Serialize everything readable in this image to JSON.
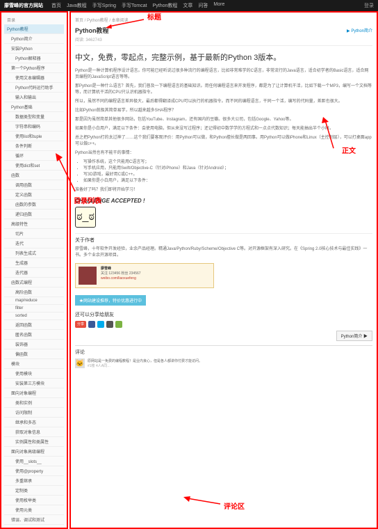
{
  "topbar": {
    "site": "廖雪峰的官方网站",
    "nav": [
      "首页",
      "Java教程",
      "手写Spring",
      "手写Tomcat",
      "Python教程",
      "文章",
      "问答",
      "More"
    ],
    "login": "登录"
  },
  "sidebar": {
    "label_toc": "目录",
    "items": [
      {
        "t": "Python教程",
        "cls": "active"
      },
      {
        "t": "Python简介",
        "cls": "sub"
      },
      {
        "t": "安装Python",
        "cls": "sub"
      },
      {
        "t": "Python解释器",
        "cls": "sub2"
      },
      {
        "t": "第一个Python程序",
        "cls": "sub"
      },
      {
        "t": "使用文本编辑器",
        "cls": "sub2"
      },
      {
        "t": "Python代码运行助手",
        "cls": "sub2"
      },
      {
        "t": "输入和输出",
        "cls": "sub2"
      },
      {
        "t": "Python基础",
        "cls": "sub"
      },
      {
        "t": "数据类型和变量",
        "cls": "sub2"
      },
      {
        "t": "字符串和编码",
        "cls": "sub2"
      },
      {
        "t": "使用list和tuple",
        "cls": "sub2"
      },
      {
        "t": "条件判断",
        "cls": "sub2"
      },
      {
        "t": "循环",
        "cls": "sub2"
      },
      {
        "t": "使用dict和set",
        "cls": "sub2"
      },
      {
        "t": "函数",
        "cls": "sub"
      },
      {
        "t": "调用函数",
        "cls": "sub2"
      },
      {
        "t": "定义函数",
        "cls": "sub2"
      },
      {
        "t": "函数的参数",
        "cls": "sub2"
      },
      {
        "t": "递归函数",
        "cls": "sub2"
      },
      {
        "t": "高级特性",
        "cls": "sub"
      },
      {
        "t": "切片",
        "cls": "sub2"
      },
      {
        "t": "迭代",
        "cls": "sub2"
      },
      {
        "t": "列表生成式",
        "cls": "sub2"
      },
      {
        "t": "生成器",
        "cls": "sub2"
      },
      {
        "t": "迭代器",
        "cls": "sub2"
      },
      {
        "t": "函数式编程",
        "cls": "sub"
      },
      {
        "t": "高阶函数",
        "cls": "sub2"
      },
      {
        "t": "map/reduce",
        "cls": "sub2"
      },
      {
        "t": "filter",
        "cls": "sub2"
      },
      {
        "t": "sorted",
        "cls": "sub2"
      },
      {
        "t": "返回函数",
        "cls": "sub2"
      },
      {
        "t": "匿名函数",
        "cls": "sub2"
      },
      {
        "t": "装饰器",
        "cls": "sub2"
      },
      {
        "t": "偏函数",
        "cls": "sub2"
      },
      {
        "t": "模块",
        "cls": "sub"
      },
      {
        "t": "使用模块",
        "cls": "sub2"
      },
      {
        "t": "安装第三方模块",
        "cls": "sub2"
      },
      {
        "t": "面向对象编程",
        "cls": "sub"
      },
      {
        "t": "类和实例",
        "cls": "sub2"
      },
      {
        "t": "访问限制",
        "cls": "sub2"
      },
      {
        "t": "继承和多态",
        "cls": "sub2"
      },
      {
        "t": "获取对象信息",
        "cls": "sub2"
      },
      {
        "t": "实例属性和类属性",
        "cls": "sub2"
      },
      {
        "t": "面向对象高级编程",
        "cls": "sub"
      },
      {
        "t": "使用__slots__",
        "cls": "sub2"
      },
      {
        "t": "使用@property",
        "cls": "sub2"
      },
      {
        "t": "多重继承",
        "cls": "sub2"
      },
      {
        "t": "定制类",
        "cls": "sub2"
      },
      {
        "t": "使用枚举类",
        "cls": "sub2"
      },
      {
        "t": "使用元类",
        "cls": "sub2"
      },
      {
        "t": "错误、调试和测试",
        "cls": "sub"
      }
    ]
  },
  "main": {
    "breadcrumb": "首页 / Python教程 / 本章阅读",
    "title": "Python教程",
    "next": "▶ Python简介",
    "reads": "阅读: 3462743",
    "hero": "中文，免费，零起点，完整示例，基于最新的Python 3版本。",
    "p1": "Python是一种计算机程序设计语言。你可能已经听说过很多种流行的编程语言，比如非常难学的C语言，非常流行的Java语言，适合初学者的Basic语言，适合网页编程的JavaScript语言等等。",
    "p2": "那Python是一种什么语言？首先，我们普及一下编程语言的基础知识。用任何编程语言来开发程序，都是为了让计算机干活，比如下载一个MP3，编写一个文档等等，而计算机干活的CPU只认识机器指令。",
    "p3": "所以，虽然不同的编程语言差异极大，最后都得翻译成CPU可以执行的机器指令。而不同的编程语言，干同一个活，编写的代码量，差距也很大。",
    "p4": "比如Python就极其简单易学，所以越来越多SHA程序？",
    "p5": "那是因为虽然简单其他很多网站，包括YouTube、Instagram，还有国内的豆瓣。很多大公司，包括Google、Yahoo等。",
    "p6": "如果你是小白用户，满足以下条件：会使用电脑，但从来没写过程序；还记得初中数学学的方程式和一点点代数知识；每天能抽出半个小时。",
    "p7": "总之把Python打的太过神了……这个我们要客观评价：用Python可以做，和Python擅长做是两回事。用Python可以做iPhone和Linux（主控制层），可以打桌面app可以做c++。",
    "p8": "Python当然也有不能干的事情：",
    "bullets": [
      "写操作系统，这个只能用C语言写；",
      "写手机应用，只能用Swift/Objective-C（针对iPhone）和Java（针对Android）；",
      "写3D游戏，最好用C或C++。",
      "如果你是小白用户，满足以下条件："
    ],
    "p9": "准备好了吗？我们即将开始学习！",
    "challenge": "CHALLENGE ACCEPTED !",
    "about_title": "关于作者",
    "about_text": "廖雪峰，十年软件开发经验，业余产品经理。精通Java/Python/Ruby/Scheme/Objective C等。对开源框架有深入研究。在《Spring 2.0核心技术与最佳实践》一书。多个业余开源项目。",
    "author_name": "廖雪峰",
    "author_meta": "关注 123456 粉丝 234567",
    "author_link": "weibo.com/liaoxuefeng",
    "promo": "★网站建设推荐，特价优惠进行中",
    "support_title": "还可以分享给朋友",
    "share_label": "分享",
    "next_btn": "Python简介 ▶",
    "comments_title": "评论",
    "comment1": "原网站是一免费的编程教程！是业内良心，但是各人都讲你付费才能访问。",
    "comment1_meta": "#1楼 4人A同…"
  },
  "annotations": {
    "title": "标题",
    "toc": "目录列表",
    "body": "正文",
    "comments": "评论区"
  }
}
